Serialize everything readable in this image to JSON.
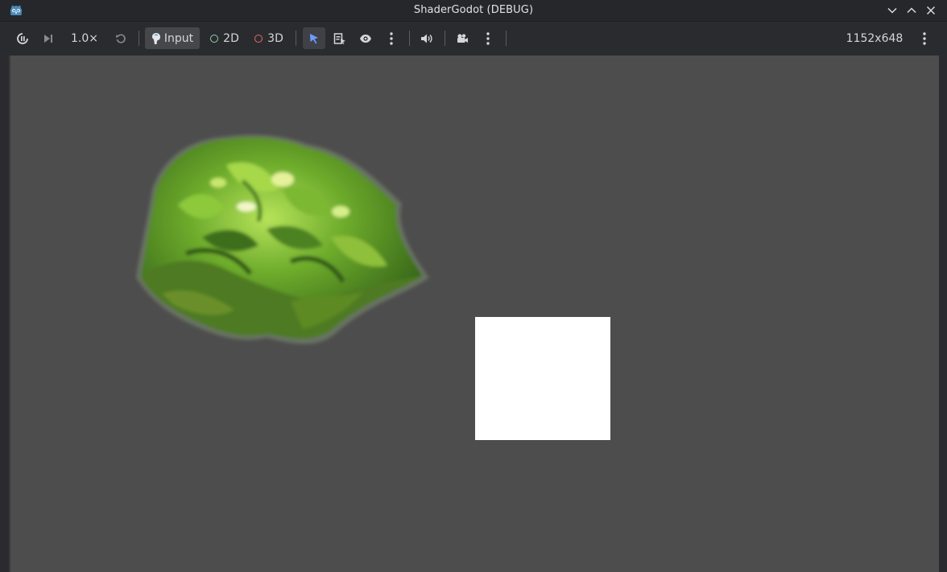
{
  "window": {
    "title": "ShaderGodot (DEBUG)",
    "icons": [
      "godot-logo-icon",
      "minimize-icon",
      "maximize-icon",
      "close-icon"
    ]
  },
  "toolbar": {
    "speed": "1.0×",
    "input_label": "Input",
    "mode_2d_label": "2D",
    "mode_3d_label": "3D",
    "resolution": "1152x648",
    "icons": [
      "suspend-icon",
      "next-frame-icon",
      "reset-speed-icon",
      "input-icon",
      "select-arrow-icon",
      "list-select-icon",
      "visibility-eye-icon",
      "more-options-icon",
      "audio-speaker-icon",
      "camera-icon",
      "more-options-icon",
      "more-options-icon"
    ]
  },
  "colors": {
    "background": "#4d4d4d",
    "toolbar": "#2a2b2f",
    "titlebar": "#26272b",
    "mode_2d_ring": "#8fd1a8",
    "mode_3d_ring": "#e36b6b",
    "selected_tool": "#6f9dff"
  },
  "scene": {
    "objects": [
      "lettuce-sprite",
      "white-square"
    ]
  }
}
